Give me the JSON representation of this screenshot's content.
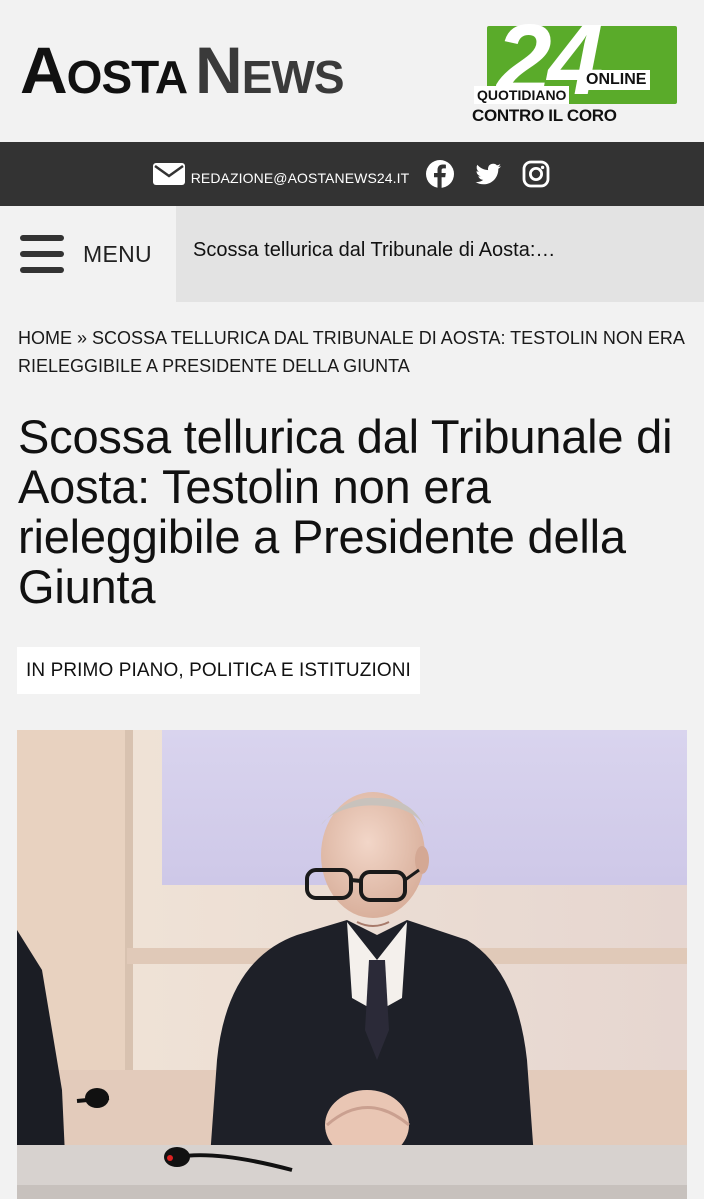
{
  "header": {
    "logo_part1_big": "A",
    "logo_part1_small": "OSTA",
    "logo_part2_big": "N",
    "logo_part2_small": "EWS",
    "badge_number": "24",
    "badge_online": "ONLINE",
    "badge_quotidiano": "QUOTIDIANO",
    "badge_tagline": "CONTRO IL CORO",
    "brand_green": "#5aab2a"
  },
  "contact_bar": {
    "email": "REDAZIONE@AOSTANEWS24.IT",
    "icons": [
      "mail-icon",
      "facebook-icon",
      "twitter-icon",
      "instagram-icon"
    ],
    "background": "#333333"
  },
  "nav": {
    "menu_label": "MENU",
    "ticker_text": "Scossa tellurica dal Tribunale di Aosta:…"
  },
  "breadcrumb": {
    "home": "HOME",
    "separator": " » ",
    "current": "SCOSSA TELLURICA DAL TRIBUNALE DI AOSTA: TESTOLIN NON ERA RIELEGGIBILE A PRESIDENTE DELLA GIUNTA"
  },
  "article": {
    "title": "Scossa tellurica dal Tribunale di Aosta: Testolin non era rieleggibile a Presidente della Giunta",
    "categories_text": "IN PRIMO PIANO, POLITICA E ISTITUZIONI"
  }
}
